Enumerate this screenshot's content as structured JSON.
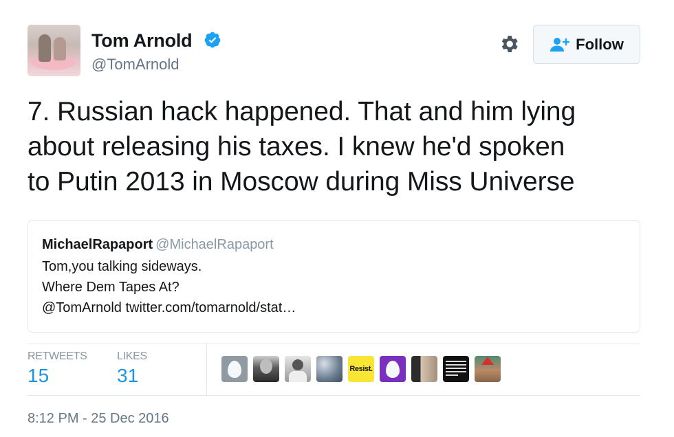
{
  "header": {
    "display_name": "Tom Arnold",
    "handle": "@TomArnold",
    "follow_label": "Follow",
    "verified_color": "#1da1f2"
  },
  "tweet": {
    "lines": [
      "7. Russian hack happened. That and him lying",
      "about releasing his taxes. I knew he'd spoken",
      "to Putin 2013 in Moscow during Miss Universe"
    ]
  },
  "quote": {
    "name": "MichaelRapaport",
    "handle": "@MichaelRapaport",
    "lines": [
      "Tom,you talking sideways.",
      "Where Dem Tapes At?",
      "@TomArnold twitter.com/tomarnold/stat…"
    ]
  },
  "stats": {
    "retweets_label": "RETWEETS",
    "retweets_count": "15",
    "likes_label": "LIKES",
    "likes_count": "31"
  },
  "likers": {
    "resist_text": "Resist.",
    "icons": [
      "default-egg-avatar",
      "lincoln-avatar",
      "person-avatar",
      "flowers-avatar",
      "resist-avatar",
      "purple-egg-avatar",
      "meme-avatar",
      "text-avatar",
      "santa-dog-avatar"
    ]
  },
  "timestamp": "8:12 PM - 25 Dec 2016",
  "colors": {
    "accent": "#1b95e0",
    "secondary_text": "#657786",
    "border": "#e1e8ed"
  }
}
